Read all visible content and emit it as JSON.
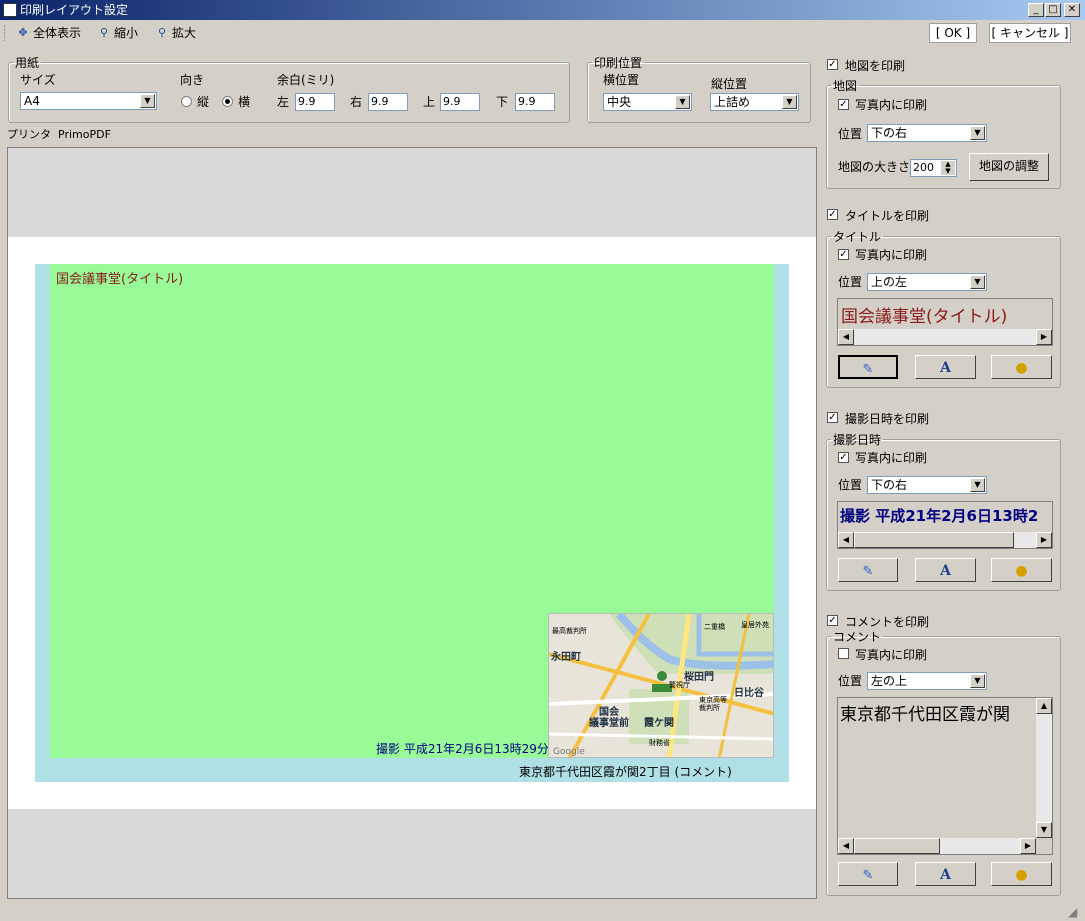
{
  "window": {
    "title": "印刷レイアウト設定"
  },
  "toolbar": {
    "fit_label": "全体表示",
    "zoom_out_label": "縮小",
    "zoom_in_label": "拡大",
    "ok_label": "[ OK ]",
    "cancel_label": "[ キャンセル ]"
  },
  "paper": {
    "legend": "用紙",
    "size_label": "サイズ",
    "size_value": "A4",
    "orientation_label": "向き",
    "portrait_label": "縦",
    "landscape_label": "横",
    "orientation_selected": "横",
    "margin_label": "余白(ミリ)",
    "left_label": "左",
    "left_value": "9.9",
    "right_label": "右",
    "right_value": "9.9",
    "top_label": "上",
    "top_value": "9.9",
    "bottom_label": "下",
    "bottom_value": "9.9"
  },
  "print_position": {
    "legend": "印刷位置",
    "horizontal_label": "横位置",
    "horizontal_value": "中央",
    "vertical_label": "縦位置",
    "vertical_value": "上詰め"
  },
  "printer": {
    "label": "プリンタ",
    "name": "PrimoPDF"
  },
  "preview": {
    "title_text": "国会議事堂(タイトル)",
    "datetime_text": "撮影 平成21年2月6日13時29分",
    "comment_text": "東京都千代田区霞が関2丁目 (コメント)",
    "map_labels": [
      "最高裁判所",
      "永田町",
      "国会",
      "議事堂前",
      "霞ケ関",
      "桜田門",
      "日比谷",
      "二重橋",
      "皇居外苑",
      "警視庁",
      "東京高等裁判所",
      "財務省",
      "Google"
    ],
    "colors": {
      "photo": "#98fb98",
      "page": "#b0e0e6",
      "title": "#8b1a1a",
      "datetime": "#000080",
      "comment": "#000000"
    }
  },
  "map_section": {
    "print_label": "地図を印刷",
    "legend": "地図",
    "in_photo_label": "写真内に印刷",
    "position_label": "位置",
    "position_value": "下の右",
    "size_label": "地図の大きさ",
    "size_value": "200",
    "adjust_label": "地図の調整"
  },
  "title_section": {
    "print_label": "タイトルを印刷",
    "legend": "タイトル",
    "in_photo_label": "写真内に印刷",
    "position_label": "位置",
    "position_value": "上の左",
    "preview_text": "国会議事堂(タイトル)"
  },
  "datetime_section": {
    "print_label": "撮影日時を印刷",
    "legend": "撮影日時",
    "in_photo_label": "写真内に印刷",
    "position_label": "位置",
    "position_value": "下の右",
    "preview_text": "撮影 平成21年2月6日13時2"
  },
  "comment_section": {
    "print_label": "コメントを印刷",
    "legend": "コメント",
    "in_photo_label": "写真内に印刷",
    "position_label": "位置",
    "position_value": "左の上",
    "preview_text": "東京都千代田区霞が関"
  }
}
